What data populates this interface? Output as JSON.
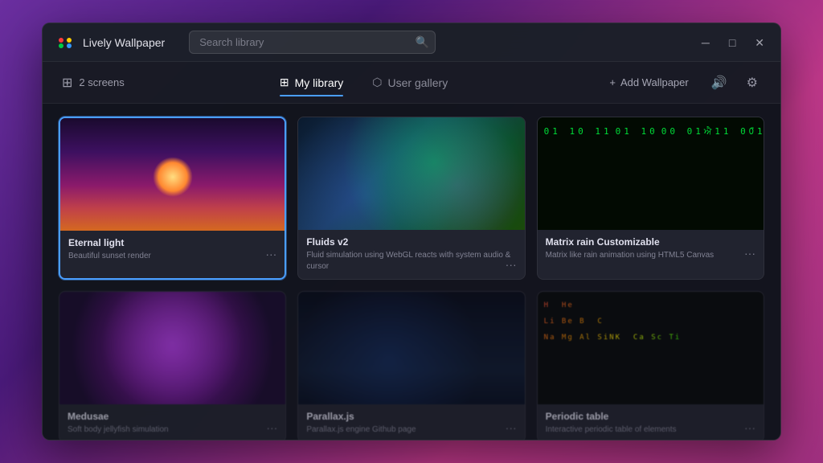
{
  "app": {
    "title": "Lively Wallpaper",
    "logo_alt": "lively-logo"
  },
  "titlebar": {
    "search_placeholder": "Search library",
    "minimize_label": "─",
    "maximize_label": "□",
    "close_label": "✕"
  },
  "toolbar": {
    "screens_icon": "⊞",
    "screens_label": "2 screens",
    "my_library_label": "My library",
    "my_library_icon": "⊞",
    "user_gallery_label": "User gallery",
    "user_gallery_icon": "⬡",
    "add_wallpaper_label": "Add Wallpaper",
    "add_icon": "+",
    "volume_icon": "🔊",
    "settings_icon": "⚙"
  },
  "wallpapers": [
    {
      "id": "eternal-light",
      "title": "Eternal light",
      "description": "Beautiful sunset render",
      "thumb_class": "thumb-eternal-light",
      "selected": true
    },
    {
      "id": "fluids-v2",
      "title": "Fluids v2",
      "description": "Fluid simulation using WebGL reacts with system audio & cursor",
      "thumb_class": "thumb-fluids",
      "selected": false
    },
    {
      "id": "matrix-rain",
      "title": "Matrix rain Customizable",
      "description": "Matrix like rain animation using HTML5 Canvas",
      "thumb_class": "thumb-matrix",
      "selected": false
    },
    {
      "id": "medusa",
      "title": "Medusae",
      "description": "Soft body jellyfish simulation",
      "thumb_class": "thumb-medusa",
      "selected": false,
      "dimmed": true
    },
    {
      "id": "parallax-js",
      "title": "Parallax.js",
      "description": "Parallax.js engine Github page",
      "thumb_class": "thumb-parallax",
      "selected": false,
      "dimmed": true
    },
    {
      "id": "periodic-table",
      "title": "Periodic table",
      "description": "Interactive periodic table of elements",
      "thumb_class": "thumb-periodic",
      "selected": false,
      "dimmed": true
    }
  ]
}
